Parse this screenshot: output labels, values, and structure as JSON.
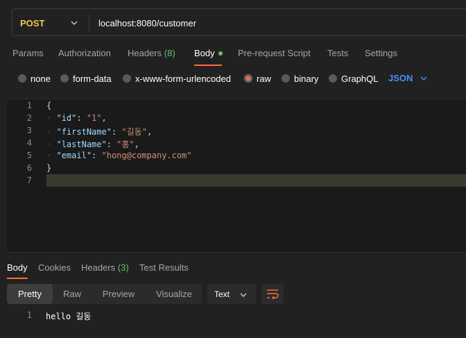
{
  "request": {
    "method": "POST",
    "url": "localhost:8080/customer"
  },
  "request_tabs": [
    {
      "label": "Params"
    },
    {
      "label": "Authorization"
    },
    {
      "label": "Headers",
      "count": "(8)"
    },
    {
      "label": "Body"
    },
    {
      "label": "Pre-request Script"
    },
    {
      "label": "Tests"
    },
    {
      "label": "Settings"
    }
  ],
  "body_types": [
    {
      "label": "none"
    },
    {
      "label": "form-data"
    },
    {
      "label": "x-www-form-urlencoded"
    },
    {
      "label": "raw",
      "selected": true
    },
    {
      "label": "binary"
    },
    {
      "label": "GraphQL"
    }
  ],
  "raw_format": "JSON",
  "editor": {
    "line_numbers": [
      "1",
      "2",
      "3",
      "4",
      "5",
      "6",
      "7"
    ],
    "open_brace": "{",
    "close_brace": "}",
    "fields": [
      {
        "key": "\"id\"",
        "value": "\"1\"",
        "sep": ","
      },
      {
        "key": "\"firstName\"",
        "value": "\"길동\"",
        "sep": ","
      },
      {
        "key": "\"lastName\"",
        "value": "\"홍\"",
        "sep": ","
      },
      {
        "key": "\"email\"",
        "value": "\"hong@company.com\"",
        "sep": ""
      }
    ]
  },
  "response_tabs": [
    {
      "label": "Body"
    },
    {
      "label": "Cookies"
    },
    {
      "label": "Headers",
      "count": "(3)"
    },
    {
      "label": "Test Results"
    }
  ],
  "view_modes": [
    "Pretty",
    "Raw",
    "Preview",
    "Visualize"
  ],
  "response_format": "Text",
  "response": {
    "line_number": "1",
    "text": "hello 길동"
  },
  "colors": {
    "accent": "#ff6c37",
    "method": "#f2c94c",
    "json_blue": "#4d8dff",
    "count_green": "#6ac26a"
  }
}
